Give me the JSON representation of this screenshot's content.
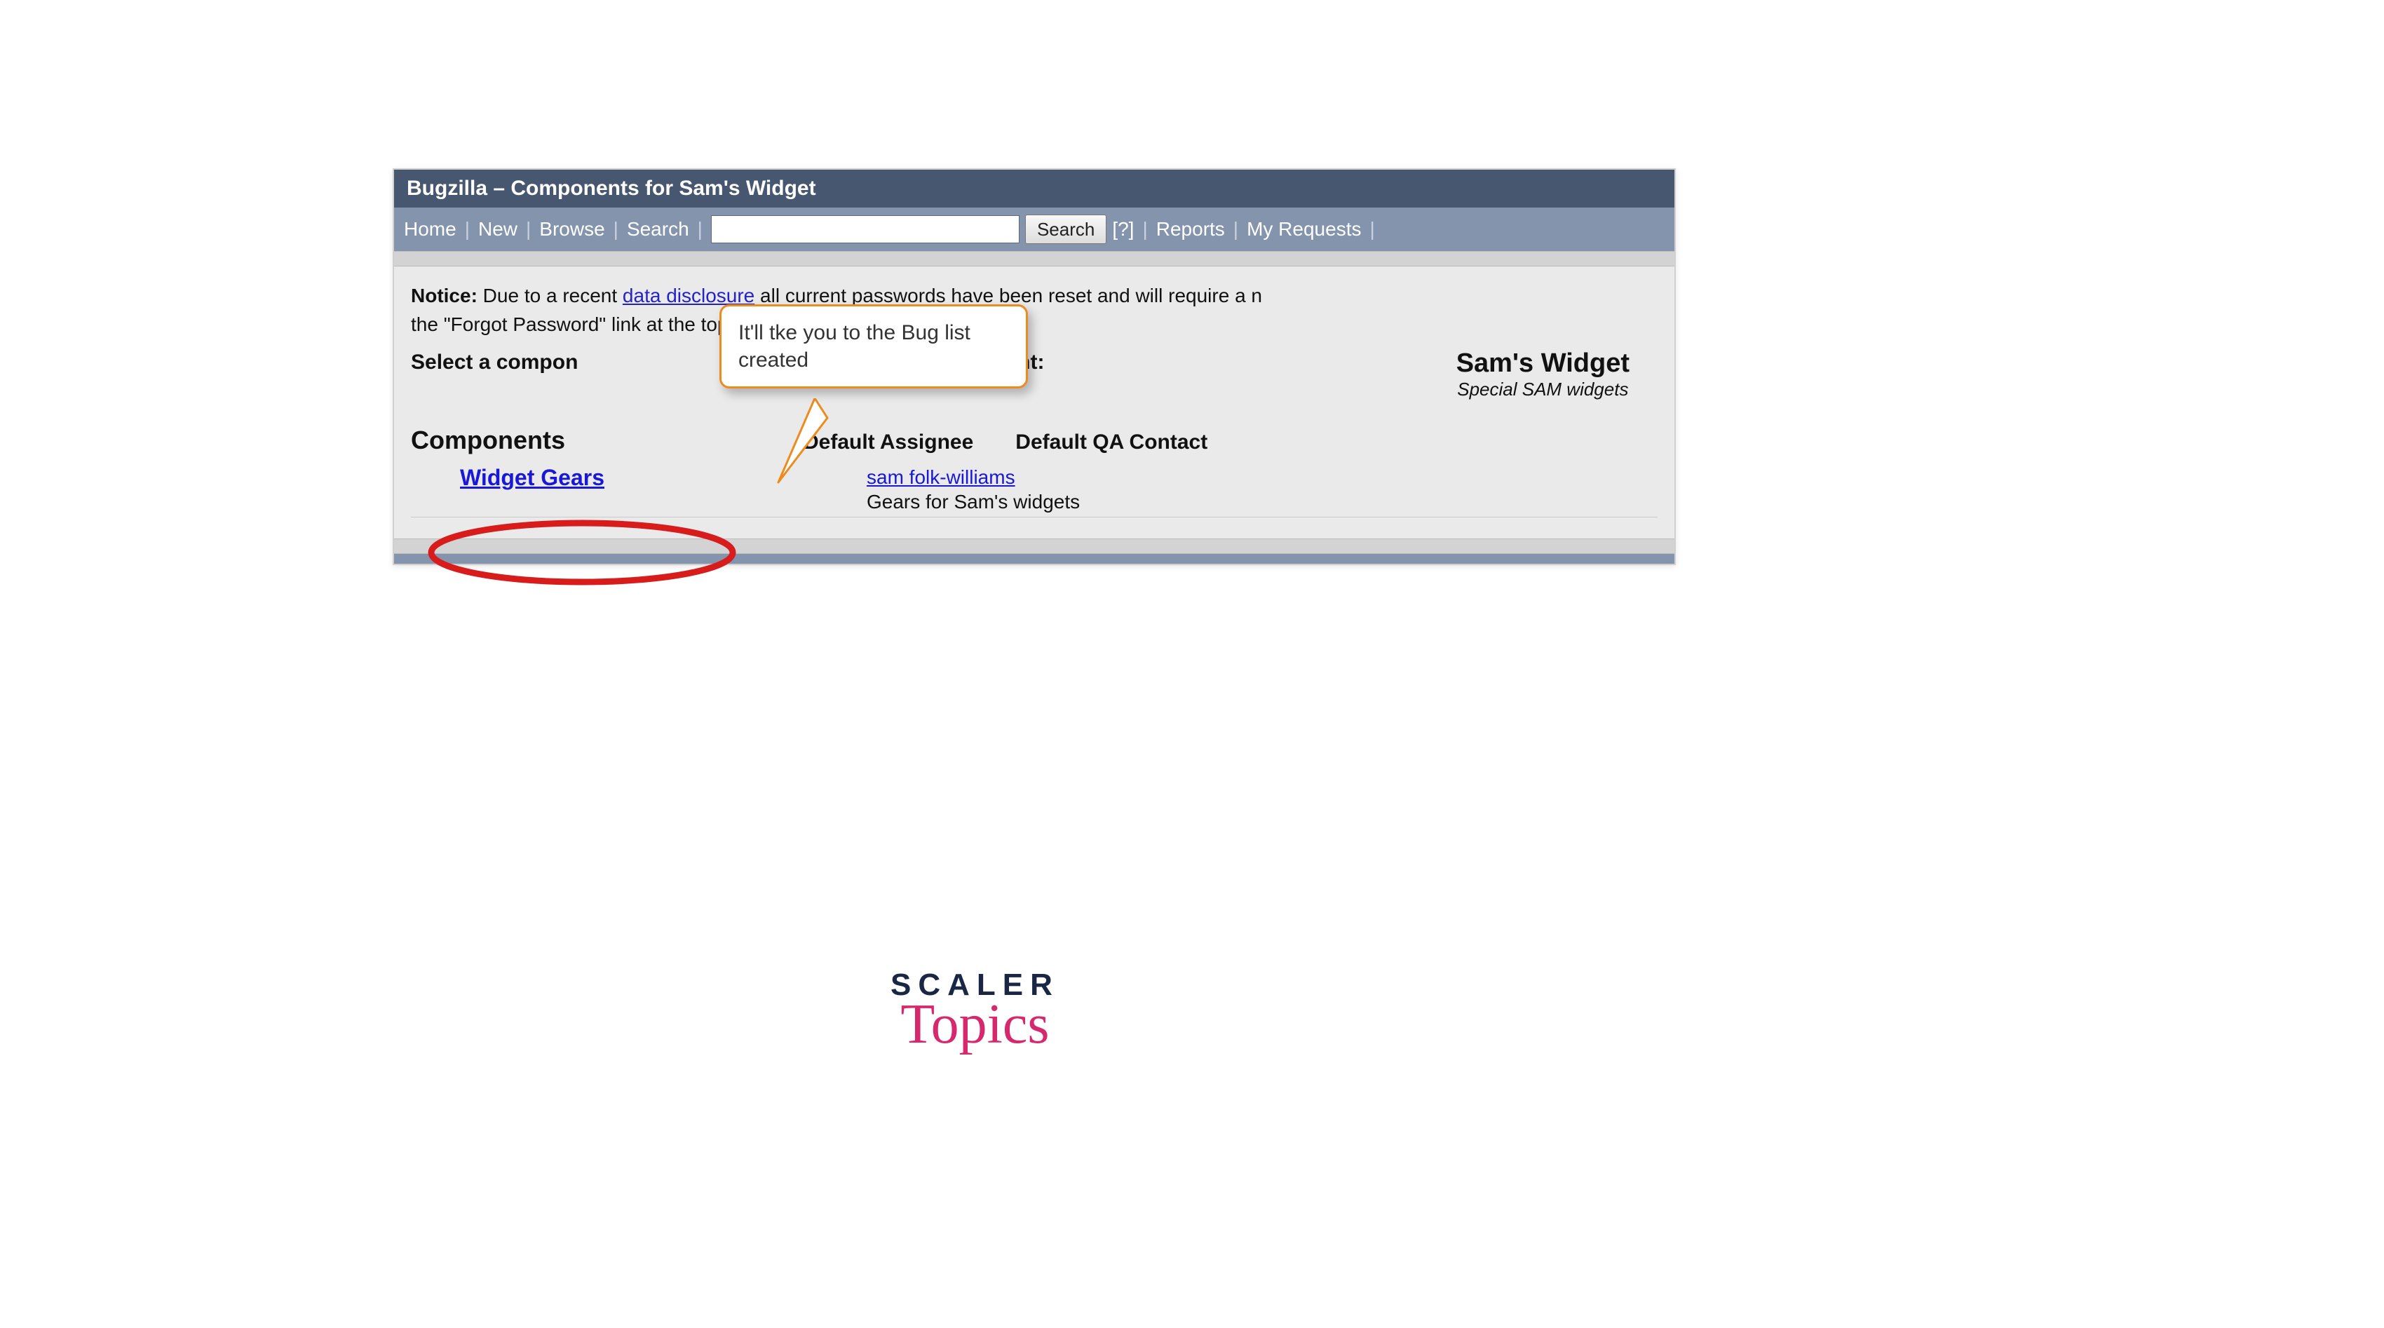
{
  "titlebar": "Bugzilla – Components for Sam's Widget",
  "nav": {
    "home": "Home",
    "new": "New",
    "browse": "Browse",
    "search_link": "Search",
    "search_btn": "Search",
    "help": "[?]",
    "reports": "Reports",
    "my_requests": "My Requests"
  },
  "notice": {
    "label": "Notice:",
    "pre": " Due to a recent ",
    "link": "data disclosure",
    "post": " all current passwords have been reset and will require a n",
    "line2": "the \"Forgot Password\" link at the top"
  },
  "select_text_a": "Select a compon",
  "select_text_b": "ugs in that component:",
  "product": {
    "title": "Sam's Widget",
    "subtitle": "Special SAM widgets"
  },
  "columns": {
    "components": "Components",
    "assignee": "Default Assignee",
    "qa": "Default QA Contact"
  },
  "row": {
    "component": "Widget Gears",
    "assignee": "sam folk-williams",
    "desc": "Gears for Sam's widgets"
  },
  "callout": "It'll tke you to the Bug list created",
  "brand": {
    "top": "SCALER",
    "bottom": "Topics"
  }
}
